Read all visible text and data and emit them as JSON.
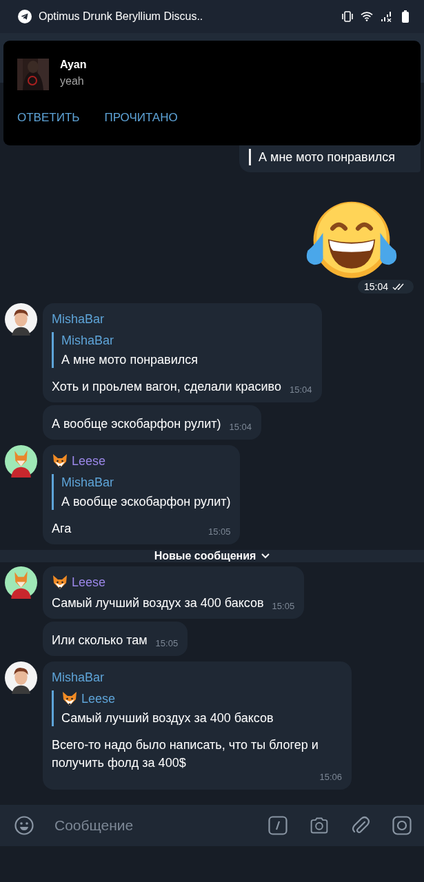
{
  "status_bar": {
    "title": "Optimus Drunk Beryllium Discus.."
  },
  "notification": {
    "sender": "Ayan",
    "text": "yeah",
    "actions": [
      "ОТВЕТИТЬ",
      "ПРОЧИТАНО"
    ]
  },
  "messages": [
    {
      "kind": "quote_out",
      "quote_text": "А мне мото понравился"
    },
    {
      "kind": "sticker",
      "time": "15:04",
      "read": true
    },
    {
      "kind": "group",
      "author": "MishaBar",
      "avatar": {
        "kind": "man"
      },
      "color": "#5ea4d8",
      "bubbles": [
        {
          "reply": {
            "author": "MishaBar",
            "text": "А мне мото понравился"
          },
          "text": "Хоть и проьлем вагон, сделали красиво",
          "time": "15:04"
        },
        {
          "text": "А вообще эскобарфон рулит)",
          "time": "15:04"
        }
      ]
    },
    {
      "kind": "group",
      "author": "Leese",
      "avatar": {
        "kind": "fox"
      },
      "badge": {
        "kind": "fox"
      },
      "color": "#9b87e8",
      "bubbles": [
        {
          "reply": {
            "author": "MishaBar",
            "text": "А вообще эскобарфон рулит)"
          },
          "text": "Ага",
          "time": "15:05"
        }
      ]
    },
    {
      "kind": "divider",
      "text": "Новые сообщения"
    },
    {
      "kind": "group",
      "author": "Leese",
      "avatar": {
        "kind": "fox"
      },
      "badge": {
        "kind": "fox"
      },
      "color": "#9b87e8",
      "bubbles": [
        {
          "text": "Самый лучший воздух за 400 баксов",
          "time": "15:05"
        },
        {
          "text": "Или сколько там",
          "time": "15:05"
        }
      ]
    },
    {
      "kind": "group",
      "author": "MishaBar",
      "avatar": {
        "kind": "man"
      },
      "color": "#5ea4d8",
      "bubbles": [
        {
          "reply": {
            "author": "Leese",
            "badge": {
              "kind": "fox"
            },
            "text": "Самый лучший воздух за 400 баксов"
          },
          "text": "Всего-то надо было написать, что ты блогер и получить фолд за 400$",
          "time": "15:06"
        }
      ]
    }
  ],
  "composer": {
    "placeholder": "Сообщение"
  }
}
